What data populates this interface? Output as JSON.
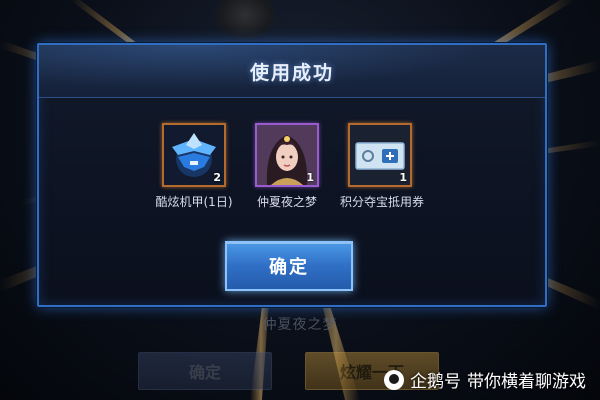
{
  "dialog": {
    "title": "使用成功",
    "confirm_label": "确定"
  },
  "items": [
    {
      "label": "酷炫机甲(1日)",
      "count": "2",
      "icon": "mech-armor-icon",
      "frame_color": "#b36a2c"
    },
    {
      "label": "仲夏夜之梦",
      "count": "1",
      "icon": "hero-skin-portrait",
      "frame_color": "#9a5bd1"
    },
    {
      "label": "积分夺宝抵用券",
      "count": "1",
      "icon": "voucher-ticket-icon",
      "frame_color": "#b36a2c"
    }
  ],
  "background": {
    "skin_name": "仲夏夜之梦",
    "left_button_label": "确定",
    "right_button_label": "炫耀一下"
  },
  "watermark": {
    "brand": "企鹅号",
    "author": "带你横着聊游戏"
  },
  "colors": {
    "dialog_border": "#2f6ec2",
    "confirm_button": "#2f6fc6",
    "orange_frame": "#b36a2c",
    "purple_frame": "#9a5bd1"
  }
}
